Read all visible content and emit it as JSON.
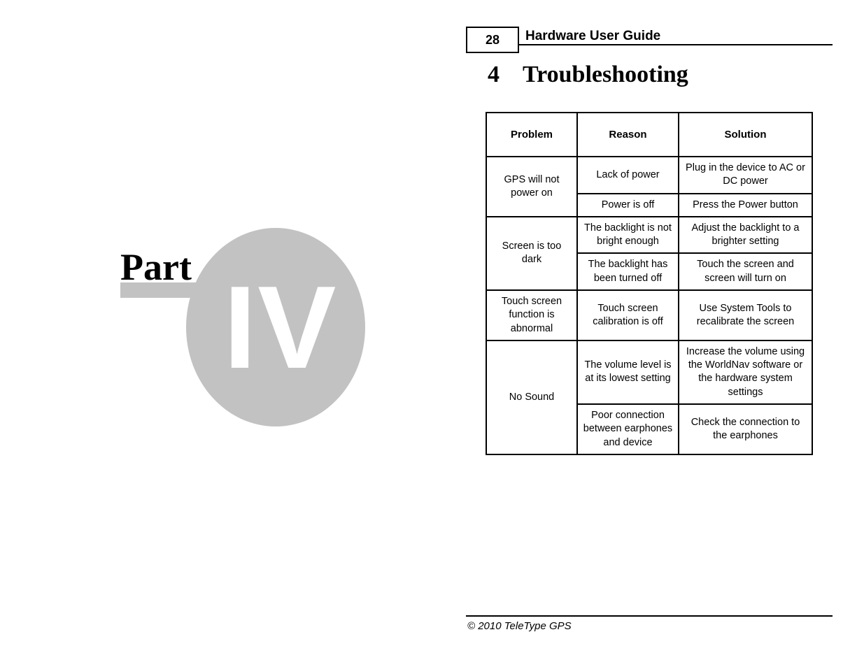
{
  "header": {
    "page_number": "28",
    "title": "Hardware User Guide"
  },
  "chapter": {
    "number": "4",
    "title": "Troubleshooting"
  },
  "part_graphic": {
    "label": "Part",
    "numeral": "IV",
    "circle_color": "#c2c2c2",
    "numeral_color": "#ffffff",
    "label_color": "#000000"
  },
  "table": {
    "columns": [
      "Problem",
      "Reason",
      "Solution"
    ],
    "groups": [
      {
        "problem": "GPS will not power on",
        "rows": [
          {
            "reason": "Lack of power",
            "solution": "Plug in the device to AC or DC power"
          },
          {
            "reason": "Power is off",
            "solution": "Press the Power button"
          }
        ]
      },
      {
        "problem": "Screen is too dark",
        "rows": [
          {
            "reason": "The backlight is not bright enough",
            "solution": "Adjust the backlight to a brighter setting"
          },
          {
            "reason": "The backlight has been turned off",
            "solution": "Touch the screen and screen will turn on"
          }
        ]
      },
      {
        "problem": "Touch screen function is abnormal",
        "rows": [
          {
            "reason": "Touch screen calibration is off",
            "solution": "Use System Tools to recalibrate the screen"
          }
        ]
      },
      {
        "problem": "No Sound",
        "rows": [
          {
            "reason": "The volume level is at its lowest setting",
            "solution": "Increase the volume using the WorldNav software or the hardware system settings"
          },
          {
            "reason": "Poor connection between earphones and device",
            "solution": "Check the connection to the earphones"
          }
        ]
      }
    ]
  },
  "footer": {
    "copyright": "© 2010 TeleType GPS"
  }
}
